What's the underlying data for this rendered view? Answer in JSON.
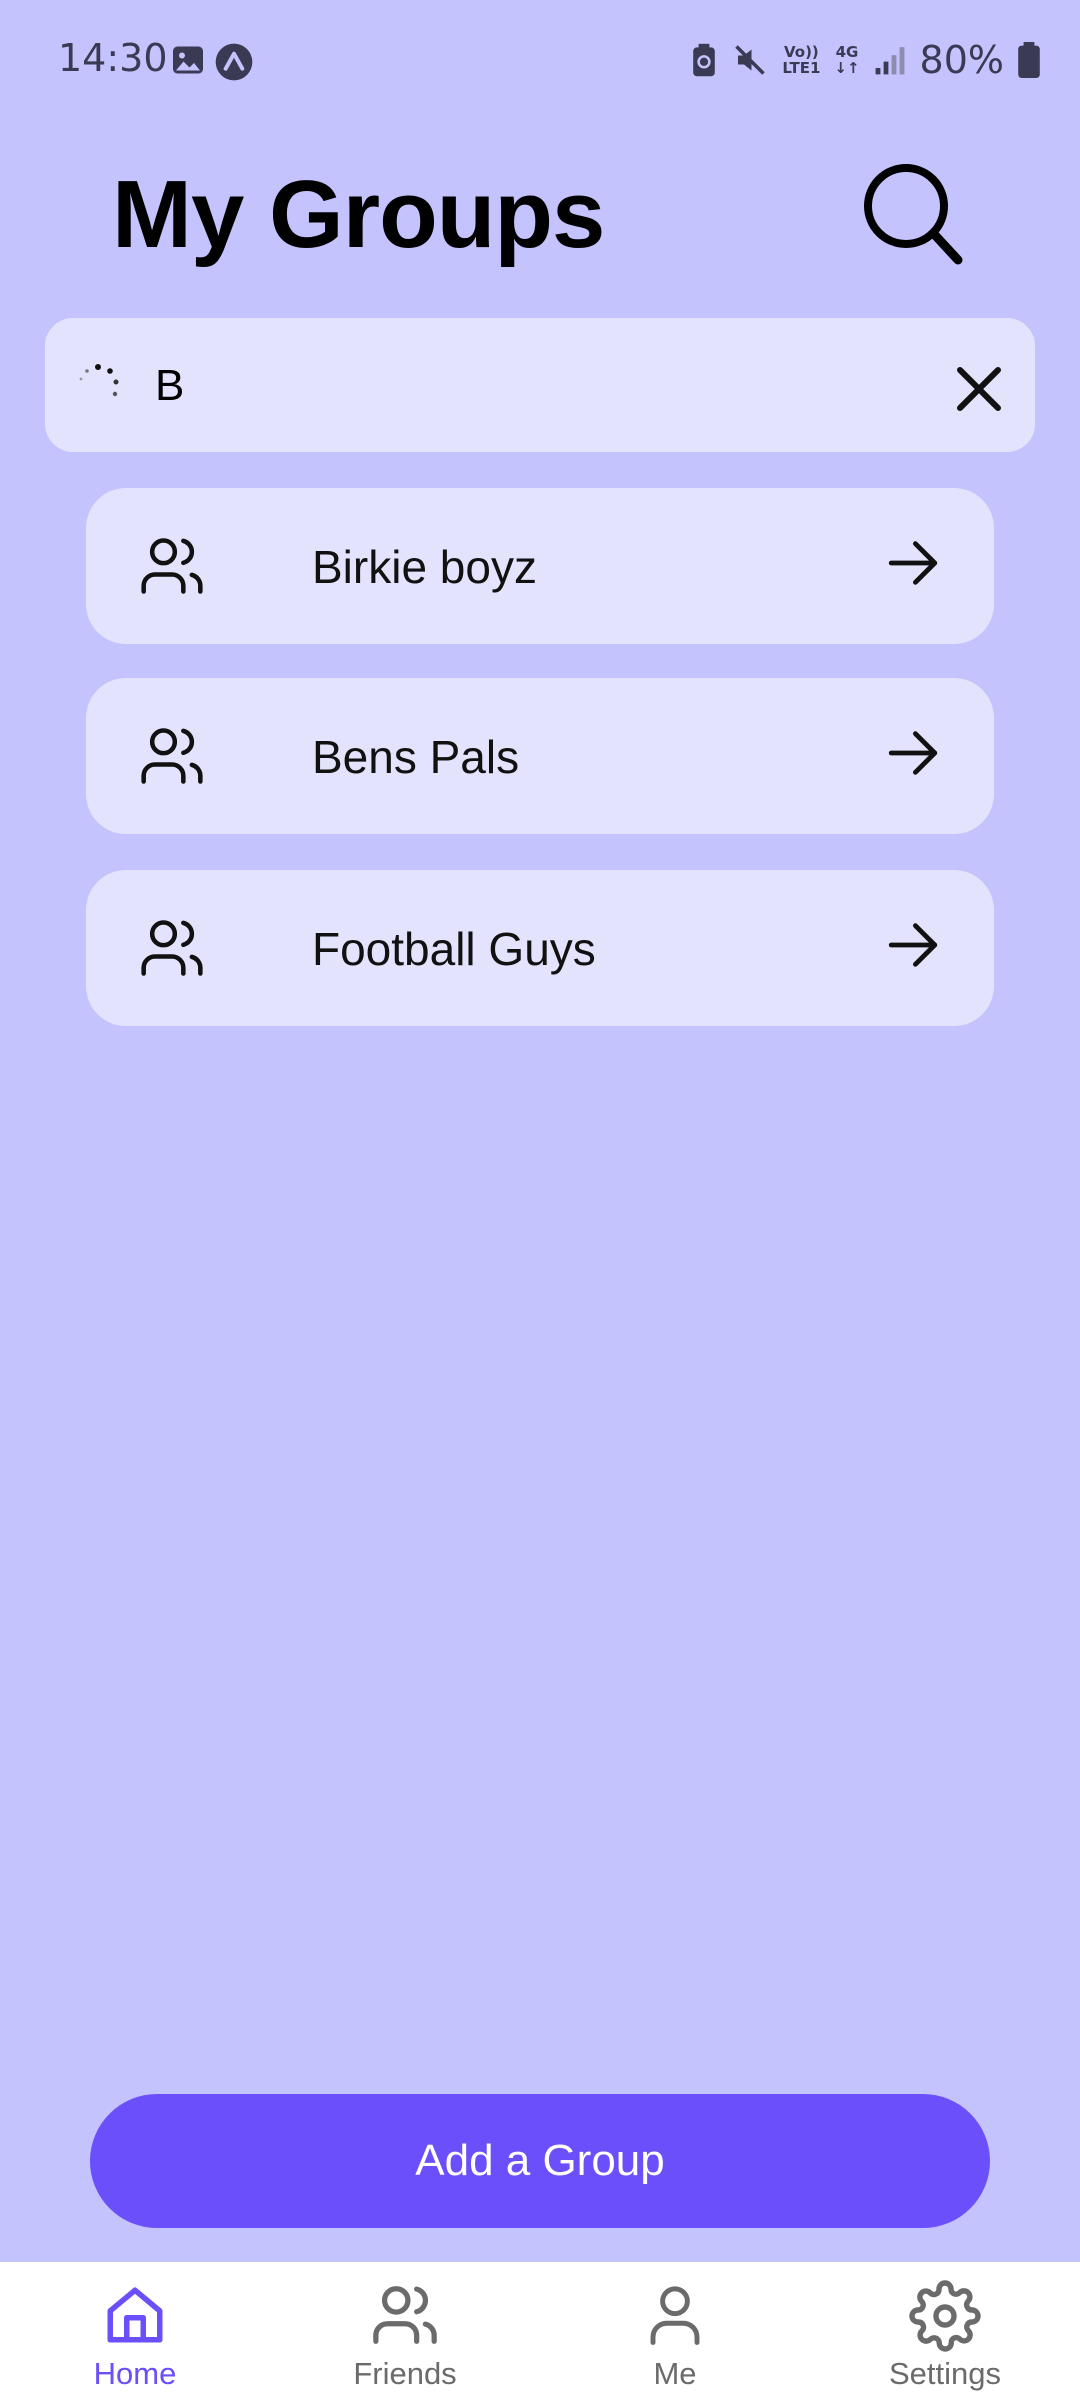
{
  "status_bar": {
    "time": "14:30",
    "network_label": "Vo)) LTE1",
    "network_type": "4G",
    "battery": "80%",
    "icons": [
      "gallery-icon",
      "app-notification-icon",
      "battery-saver-icon",
      "mute-icon",
      "volte-icon",
      "4g-data-icon",
      "signal-icon",
      "battery-icon"
    ]
  },
  "header": {
    "title": "My Groups",
    "search_icon": "search-icon"
  },
  "search": {
    "value": "B",
    "loading": true,
    "clear_icon": "close-icon"
  },
  "groups": [
    {
      "name": "Birkie boyz",
      "icon": "group-icon",
      "action_icon": "arrow-right-icon"
    },
    {
      "name": "Bens Pals",
      "icon": "group-icon",
      "action_icon": "arrow-right-icon"
    },
    {
      "name": "Football Guys",
      "icon": "group-icon",
      "action_icon": "arrow-right-icon"
    }
  ],
  "add_button": {
    "label": "Add a Group"
  },
  "bottom_nav": {
    "items": [
      {
        "label": "Home",
        "icon": "home-icon",
        "active": true
      },
      {
        "label": "Friends",
        "icon": "friends-icon",
        "active": false
      },
      {
        "label": "Me",
        "icon": "person-icon",
        "active": false
      },
      {
        "label": "Settings",
        "icon": "gear-icon",
        "active": false
      }
    ]
  },
  "colors": {
    "background": "#C5C3FD",
    "card": "#E4E3FE",
    "accent": "#6A4FFB",
    "nav_background": "#FFFFFF"
  }
}
